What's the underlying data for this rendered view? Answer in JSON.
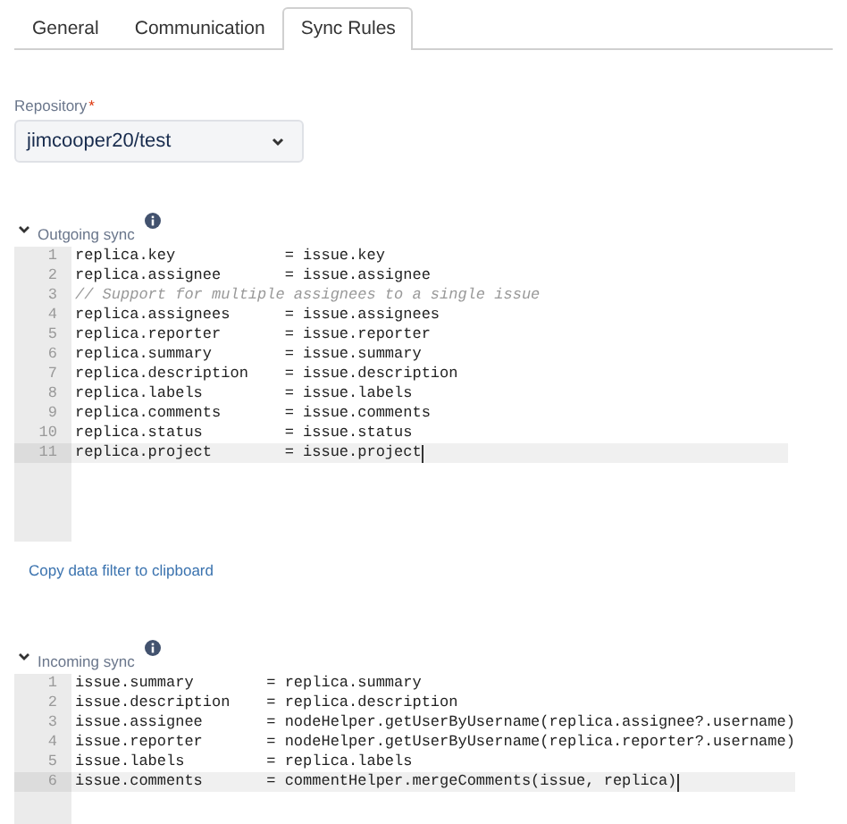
{
  "tabs": [
    {
      "label": "General",
      "selected": false
    },
    {
      "label": "Communication",
      "selected": false
    },
    {
      "label": "Sync Rules",
      "selected": true
    }
  ],
  "repository": {
    "label": "Repository",
    "required_mark": "*",
    "value": "jimcooper20/test"
  },
  "outgoing": {
    "title": "Outgoing sync",
    "lines": [
      {
        "number": "1",
        "text": "replica.key            = issue.key",
        "kind": "code",
        "selected": false
      },
      {
        "number": "2",
        "text": "replica.assignee       = issue.assignee",
        "kind": "code",
        "selected": false
      },
      {
        "number": "3",
        "text": "// Support for multiple assignees to a single issue",
        "kind": "comment",
        "selected": false
      },
      {
        "number": "4",
        "text": "replica.assignees      = issue.assignees",
        "kind": "code",
        "selected": false
      },
      {
        "number": "5",
        "text": "replica.reporter       = issue.reporter",
        "kind": "code",
        "selected": false
      },
      {
        "number": "6",
        "text": "replica.summary        = issue.summary",
        "kind": "code",
        "selected": false
      },
      {
        "number": "7",
        "text": "replica.description    = issue.description",
        "kind": "code",
        "selected": false
      },
      {
        "number": "8",
        "text": "replica.labels         = issue.labels",
        "kind": "code",
        "selected": false
      },
      {
        "number": "9",
        "text": "replica.comments       = issue.comments",
        "kind": "code",
        "selected": false
      },
      {
        "number": "10",
        "text": "replica.status         = issue.status",
        "kind": "code",
        "selected": false
      },
      {
        "number": "11",
        "text": "replica.project        = issue.project",
        "kind": "code",
        "selected": true
      }
    ]
  },
  "copy_link": "Copy data filter to clipboard",
  "incoming": {
    "title": "Incoming sync",
    "lines": [
      {
        "number": "1",
        "text": "issue.summary        = replica.summary",
        "selected": false
      },
      {
        "number": "2",
        "text": "issue.description    = replica.description",
        "selected": false
      },
      {
        "number": "3",
        "text": "issue.assignee       = nodeHelper.getUserByUsername(replica.assignee?.username)",
        "selected": false
      },
      {
        "number": "4",
        "text": "issue.reporter       = nodeHelper.getUserByUsername(replica.reporter?.username)",
        "selected": false
      },
      {
        "number": "5",
        "text": "issue.labels         = replica.labels",
        "selected": false
      },
      {
        "number": "6",
        "text": "issue.comments       = commentHelper.mergeComments(issue, replica)",
        "selected": true
      }
    ]
  }
}
